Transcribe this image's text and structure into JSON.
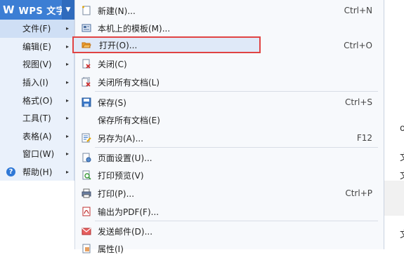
{
  "brand": {
    "logo": "W",
    "name": "WPS 文字",
    "caret": "▼"
  },
  "left_menu": [
    {
      "label": "文件(F)",
      "arrow": "▸",
      "active": true
    },
    {
      "label": "编辑(E)",
      "arrow": "▸"
    },
    {
      "label": "视图(V)",
      "arrow": "▸"
    },
    {
      "label": "插入(I)",
      "arrow": "▸"
    },
    {
      "label": "格式(O)",
      "arrow": "▸"
    },
    {
      "label": "工具(T)",
      "arrow": "▸"
    },
    {
      "label": "表格(A)",
      "arrow": "▸"
    },
    {
      "label": "窗口(W)",
      "arrow": "▸"
    },
    {
      "label": "帮助(H)",
      "arrow": "▸",
      "icon": "help-icon"
    }
  ],
  "file_menu": [
    {
      "label": "新建(N)...",
      "shortcut": "Ctrl+N",
      "icon": "new-document-icon"
    },
    {
      "label": "本机上的模板(M)...",
      "shortcut": "",
      "icon": "template-icon"
    },
    {
      "label": "打开(O)...",
      "shortcut": "Ctrl+O",
      "icon": "open-folder-icon",
      "highlighted": true
    },
    {
      "label": "关闭(C)",
      "shortcut": "",
      "icon": "close-document-icon"
    },
    {
      "label": "关闭所有文档(L)",
      "shortcut": "",
      "icon": "close-all-documents-icon"
    },
    {
      "label": "保存(S)",
      "shortcut": "Ctrl+S",
      "icon": "save-icon"
    },
    {
      "label": "保存所有文档(E)",
      "shortcut": "",
      "icon": ""
    },
    {
      "label": "另存为(A)...",
      "shortcut": "F12",
      "icon": "save-as-icon"
    },
    {
      "label": "页面设置(U)...",
      "shortcut": "",
      "icon": "page-setup-icon"
    },
    {
      "label": "打印预览(V)",
      "shortcut": "",
      "icon": "print-preview-icon"
    },
    {
      "label": "打印(P)...",
      "shortcut": "Ctrl+P",
      "icon": "printer-icon"
    },
    {
      "label": "输出为PDF(F)...",
      "shortcut": "",
      "icon": "pdf-icon"
    },
    {
      "label": "发送邮件(D)...",
      "shortcut": "",
      "icon": "mail-icon"
    },
    {
      "label": "属性(I)",
      "shortcut": "",
      "icon": "properties-icon"
    }
  ],
  "doc_edge_chars": [
    "o",
    "文",
    "文",
    "文"
  ],
  "colors": {
    "brand": "#3c7ed4",
    "highlight_border": "#e04343",
    "hover": "#dfe9f8"
  }
}
